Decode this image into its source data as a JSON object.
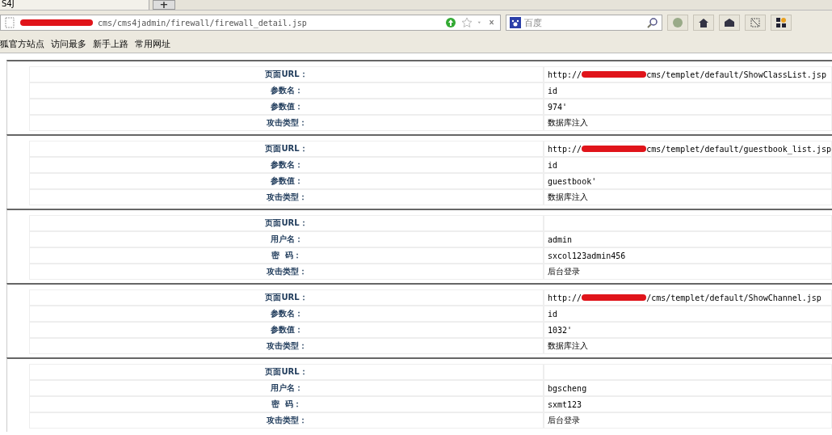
{
  "tab": {
    "title": "S4J",
    "new_tab": "+"
  },
  "address_bar": {
    "redacted": true,
    "url": "cms/cms4jadmin/firewall/firewall_detail.jsp"
  },
  "search": {
    "placeholder": "百度"
  },
  "bookmarks": [
    "狐官方站点",
    "访问最多",
    "新手上路",
    "常用网址"
  ],
  "records": [
    {
      "rows": [
        {
          "label": "页面URL：",
          "prefix": "http://",
          "value": "cms/templet/default/ShowClassList.jsp"
        },
        {
          "label": "参数名：",
          "value": "id"
        },
        {
          "label": "参数值：",
          "value": "974'"
        },
        {
          "label": "攻击类型：",
          "value": "数据库注入"
        }
      ]
    },
    {
      "rows": [
        {
          "label": "页面URL：",
          "prefix": "http://",
          "value": "cms/templet/default/guestbook_list.jsp"
        },
        {
          "label": "参数名：",
          "value": "id"
        },
        {
          "label": "参数值：",
          "value": "guestbook'"
        },
        {
          "label": "攻击类型：",
          "value": "数据库注入"
        }
      ]
    },
    {
      "rows": [
        {
          "label": "页面URL："
        },
        {
          "label": "用户名：",
          "value": "admin"
        },
        {
          "label": "密  码：",
          "value": "sxcol123admin456"
        },
        {
          "label": "攻击类型：",
          "value": "后台登录"
        }
      ]
    },
    {
      "rows": [
        {
          "label": "页面URL：",
          "prefix": "http://",
          "value": "/cms/templet/default/ShowChannel.jsp"
        },
        {
          "label": "参数名：",
          "value": "id"
        },
        {
          "label": "参数值：",
          "value": "1032'"
        },
        {
          "label": "攻击类型：",
          "value": "数据库注入"
        }
      ]
    },
    {
      "rows": [
        {
          "label": "页面URL："
        },
        {
          "label": "用户名：",
          "value": "bgscheng"
        },
        {
          "label": "密  码：",
          "value": "sxmt123"
        },
        {
          "label": "攻击类型：",
          "value": "后台登录"
        }
      ]
    }
  ]
}
